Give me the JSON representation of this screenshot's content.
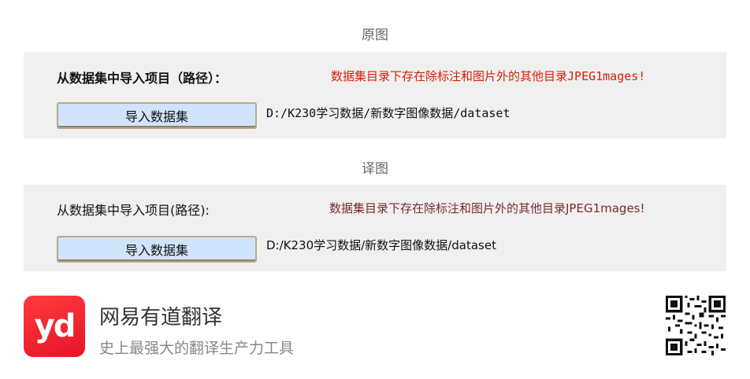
{
  "original": {
    "section_title": "原图",
    "prompt": "从数据集中导入项目（路径）：",
    "warning": "数据集目录下存在除标注和图片外的其他目录JPEG1mages!",
    "button": "导入数据集",
    "path": "D:/K230学习数据/新数字图像数据/dataset"
  },
  "translated": {
    "section_title": "译图",
    "prompt": "从数据集中导入项目(路径):",
    "warning": "数据集目录下存在除标注和图片外的其他目录JPEG1mages!",
    "button": "导入数据集",
    "path": "D:/K230学习数据/新数字图像数据/dataset"
  },
  "footer": {
    "logo_text": "yd",
    "brand": "网易有道翻译",
    "slogan": "史上最强大的翻译生产力工具",
    "qr_icon": "qr-code-icon"
  },
  "colors": {
    "warning_original": "#d81e06",
    "warning_translated": "#7a2a2a",
    "button_bg": "#cfe4fb",
    "panel_bg": "#f0f0f0"
  }
}
